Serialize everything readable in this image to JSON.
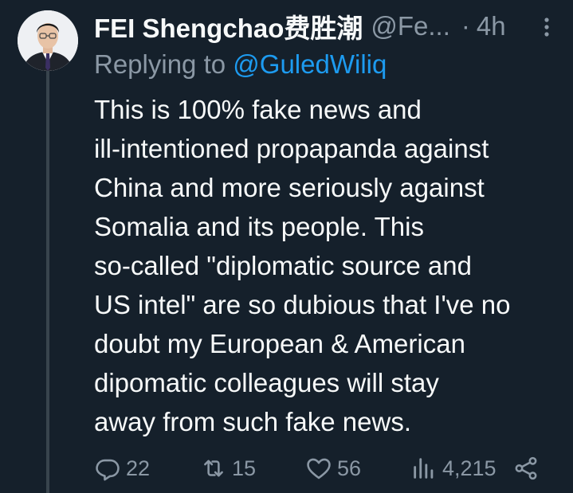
{
  "tweet": {
    "author_name": "FEI Shengchao费胜潮",
    "author_handle": "@Fe...",
    "separator": "·",
    "timestamp": "4h",
    "replying_label": "Replying to",
    "replying_handle": "@GuledWiliq",
    "text_lines": [
      "This is 100% fake news and",
      "ill-intentioned propapanda against",
      "China and more seriously against",
      "Somalia and its people. This",
      "so-called \"diplomatic source and",
      "US intel\" are so dubious that I've no",
      "doubt my European & American",
      "dipomatic colleagues will stay",
      "away from such fake news."
    ]
  },
  "actions": {
    "reply_count": "22",
    "retweet_count": "15",
    "like_count": "56",
    "view_count": "4,215"
  },
  "icons": {
    "more": "more-vertical-icon",
    "reply": "reply-icon",
    "retweet": "retweet-icon",
    "like": "heart-icon",
    "views": "views-chart-icon",
    "share": "share-icon"
  },
  "colors": {
    "background": "#15202b",
    "primary_text": "#f7f9f9",
    "secondary_text": "#8b98a5",
    "accent": "#1d9bf0",
    "thread_line": "#38444d"
  }
}
